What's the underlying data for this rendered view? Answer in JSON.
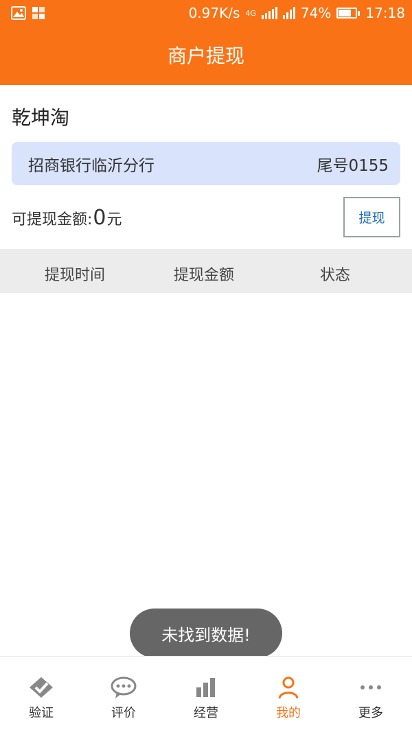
{
  "status_bar": {
    "net_speed": "0.97K/s",
    "network": "4G",
    "battery": "74%",
    "battery_level": 0.74,
    "time": "17:18",
    "icons": [
      "image-icon",
      "app-grid-icon",
      "signal-icon",
      "battery-icon"
    ]
  },
  "header": {
    "title": "商户提现"
  },
  "merchant": {
    "name": "乾坤淘"
  },
  "bank": {
    "name": "招商银行临沂分行",
    "tail": "尾号0155"
  },
  "balance": {
    "label": "可提现金额:",
    "amount": "0",
    "unit": "元"
  },
  "withdraw_button": {
    "label": "提现"
  },
  "table": {
    "columns": [
      "提现时间",
      "提现金额",
      "状态"
    ]
  },
  "toast": {
    "message": "未找到数据!"
  },
  "bottom_nav": {
    "active": "我的",
    "items": [
      {
        "label": "验证",
        "icon": "verify-icon"
      },
      {
        "label": "评价",
        "icon": "comment-icon"
      },
      {
        "label": "经营",
        "icon": "bar-chart-icon"
      },
      {
        "label": "我的",
        "icon": "person-icon"
      },
      {
        "label": "更多",
        "icon": "more-icon"
      }
    ]
  },
  "colors": {
    "primary": "#f97316",
    "bank_card_bg": "#d9e4fc",
    "button_text": "#1f6fb5",
    "table_header_bg": "#ececec",
    "toast_bg": "#666666"
  }
}
